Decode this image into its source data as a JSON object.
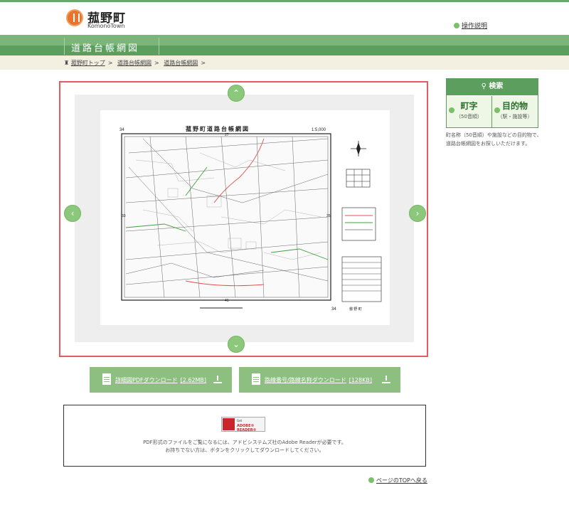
{
  "header": {
    "logo_name": "菰野町",
    "logo_subtitle": "KomonoTown",
    "help_link": "操作説明"
  },
  "nav": {
    "title": "道路台帳網図"
  },
  "breadcrumb": {
    "items": [
      "菰野町トップ",
      "道路台帳網図",
      "道路台帳網図"
    ]
  },
  "viewer": {
    "icons": {
      "up": "chevron-up-icon",
      "down": "chevron-down-icon",
      "left": "chevron-left-icon",
      "right": "chevron-right-icon"
    },
    "map": {
      "title": "菰野町道路台帳網図",
      "scale": "1:5,000",
      "sheet_number": "34",
      "top_number": "27",
      "bottom_number": "41",
      "left_number": "33",
      "right_number": "35",
      "footer_label": "菰 野 町",
      "index_grid": [
        "26",
        "27",
        "28",
        "33",
        "34",
        "35",
        "40",
        "41",
        "42"
      ]
    }
  },
  "search": {
    "heading": "検索",
    "buttons": [
      {
        "label": "町字",
        "sub": "（50音順）"
      },
      {
        "label": "目的物",
        "sub": "（駅・施設等）"
      }
    ],
    "description": "町名称（50音順）や施設などの目的物で、道路台帳網図をお探しいただけます。"
  },
  "downloads": [
    {
      "label": "詳細図PDFダウンロード",
      "size": "[2.62MB]"
    },
    {
      "label": "路線番号/路線名称ダウンロード",
      "size": "[128KB]"
    }
  ],
  "adobe": {
    "badge_line1": "Get",
    "badge_line2": "ADOBE® READER®",
    "line1": "PDF形式のファイルをご覧になるには、アドビシステムズ社のAdobe Readerが必要です。",
    "line2": "お持ちでない方は、ボタンをクリックしてダウンロードしてください。"
  },
  "footer": {
    "pagetop": "ページのTOPへ戻る"
  },
  "colors": {
    "green_dark": "#5c9e5e",
    "green_light": "#7cb57a",
    "button_green": "#8cbf80",
    "viewer_border": "#e55b61"
  }
}
